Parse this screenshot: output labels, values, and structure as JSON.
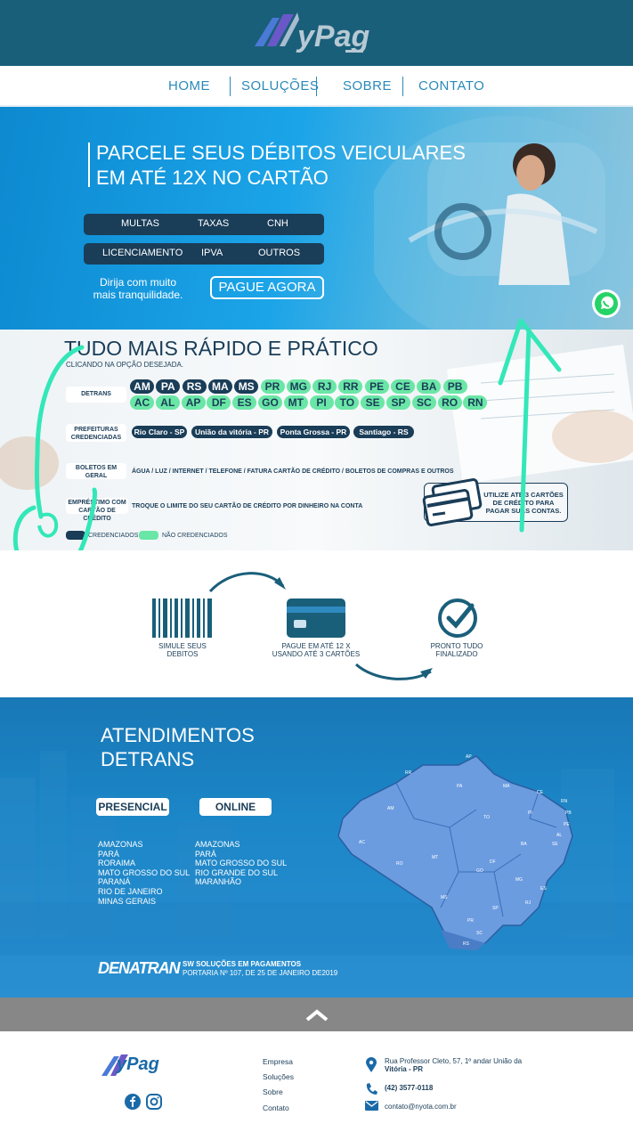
{
  "header": {
    "logo": "yPag"
  },
  "nav": {
    "home": "HOME",
    "solucoes": "SOLUÇÕES",
    "sobre": "SOBRE",
    "contato": "CONTATO"
  },
  "hero": {
    "title_line1": "PARCELE SEUS DÉBITOS VEICULARES",
    "title_line2": "EM ATÉ 12X NO CARTÃO",
    "pills_row1": [
      "MULTAS",
      "TAXAS",
      "CNH"
    ],
    "pills_row2": [
      "LICENCIAMENTO",
      "IPVA",
      "OUTROS"
    ],
    "tranquilidade": "Dirija com muito mais tranquilidade.",
    "cta": "PAGUE AGORA"
  },
  "rapido": {
    "title": "TUDO MAIS RÁPIDO E PRÁTICO",
    "subtitle": "CLICANDO NA OPÇÃO DESEJADA.",
    "detrans_label": "DETRANS",
    "prefeituras_label": "PREFEITURAS CREDENCIADAS",
    "boletos_label": "BOLETOS EM GERAL",
    "emprestimo_label": "EMPRÉSTIMO COM CARTÃO DE CRÉDITO",
    "ufs_row1": [
      {
        "uf": "AM",
        "status": "credenciado"
      },
      {
        "uf": "PA",
        "status": "credenciado"
      },
      {
        "uf": "RS",
        "status": "credenciado"
      },
      {
        "uf": "MA",
        "status": "credenciado"
      },
      {
        "uf": "MS",
        "status": "credenciado"
      },
      {
        "uf": "PR",
        "status": "nao"
      },
      {
        "uf": "MG",
        "status": "nao"
      },
      {
        "uf": "RJ",
        "status": "nao"
      },
      {
        "uf": "RR",
        "status": "nao"
      },
      {
        "uf": "PE",
        "status": "nao"
      },
      {
        "uf": "CE",
        "status": "nao"
      },
      {
        "uf": "BA",
        "status": "nao"
      },
      {
        "uf": "PB",
        "status": "nao"
      }
    ],
    "ufs_row2": [
      "AC",
      "AL",
      "AP",
      "DF",
      "ES",
      "GO",
      "MT",
      "PI",
      "TO",
      "SE",
      "SP",
      "SC",
      "RO",
      "RN"
    ],
    "cities": [
      "Rio Claro - SP",
      "União da vitória - PR",
      "Ponta Grossa - PR",
      "Santiago - RS"
    ],
    "boletos_text": "ÁGUA / LUZ / INTERNET / TELEFONE / FATURA CARTÃO DE CRÉDITO / BOLETOS DE COMPRAS E OUTROS",
    "emprestimo_text": "TROQUE O LIMITE DO SEU CARTÃO DE CRÉDITO POR DINHEIRO NA CONTA",
    "legend_cred": "CREDENCIADOS",
    "legend_nao": "NÃO CREDENCIADOS",
    "cards_text": "UTILIZE ATÉ 3 CARTÕES DE CRÉDITO PARA PAGAR SUAS CONTAS."
  },
  "steps": {
    "step1": "SIMULE SEUS DEBITOS",
    "step2": "PAGUE EM ATÉ 12 X USANDO ATÉ 3 CARTÕES",
    "step3": "PRONTO TUDO FINALIZADO"
  },
  "atend": {
    "title_line1": "ATENDIMENTOS",
    "title_line2": "DETRANS",
    "presencial_label": "PRESENCIAL",
    "online_label": "ONLINE",
    "presencial": [
      "AMAZONAS",
      "PARÁ",
      "RORAIMA",
      "MATO GROSSO DO SUL",
      "PARANÁ",
      "RIO DE JANEIRO",
      "MINAS GERAIS"
    ],
    "online": [
      "AMAZONAS",
      "PARÁ",
      "MATO GROSSO DO SUL",
      "RIO GRANDE DO SUL",
      "MARANHÃO"
    ],
    "denatran": "DENATRAN",
    "sw": "SW SOLUÇÕES EM PAGAMENTOS",
    "portaria": "PORTARIA Nº 107, DE 25 DE JANEIRO DE2019",
    "map_states": [
      "AM",
      "RR",
      "AP",
      "PA",
      "MA",
      "CE",
      "RN",
      "PB",
      "PE",
      "AL",
      "SE",
      "BA",
      "PI",
      "TO",
      "MT",
      "RO",
      "AC",
      "GO",
      "DF",
      "MG",
      "ES",
      "RJ",
      "SP",
      "MS",
      "PR",
      "SC",
      "RS"
    ]
  },
  "footer": {
    "logo": "yPag",
    "links": [
      "Empresa",
      "Soluções",
      "Sobre",
      "Contato"
    ],
    "address_line1": "Rua Professor Cleto, 57, 1º andar União da",
    "address_line2": "Vitória - PR",
    "phone": "(42) 3577-0118",
    "email": "contato@nyota.com.br"
  },
  "colors": {
    "navy": "#1a3d58",
    "mint": "#6ae6a6",
    "blue": "#1b86c8",
    "whatsapp": "#25d366"
  }
}
